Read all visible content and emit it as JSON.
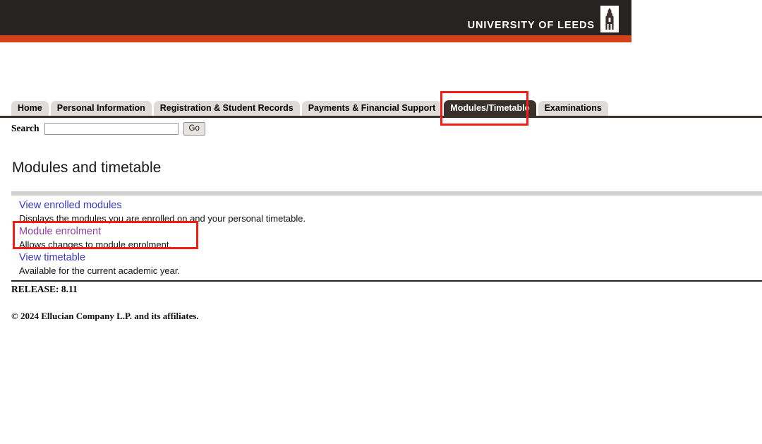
{
  "header": {
    "brand_name": "UNIVERSITY OF LEEDS",
    "logo_icon": "leeds-tower-icon",
    "bar_color": "#262322",
    "stripe_color": "#d5401a"
  },
  "tabs": [
    {
      "label": "Home",
      "active": false
    },
    {
      "label": "Personal Information",
      "active": false
    },
    {
      "label": "Registration & Student Records",
      "active": false
    },
    {
      "label": "Payments & Financial Support",
      "active": false
    },
    {
      "label": "Modules/Timetable",
      "active": true
    },
    {
      "label": "Examinations",
      "active": false
    }
  ],
  "search": {
    "label": "Search",
    "value": "",
    "placeholder": "",
    "button_label": "Go"
  },
  "main": {
    "title": "Modules and timetable",
    "links": [
      {
        "label": "View enrolled modules",
        "description": "Displays the modules you are enrolled on and your personal timetable.",
        "visited": false
      },
      {
        "label": "Module enrolment",
        "description": "Allows changes to module enrolment.",
        "visited": true
      },
      {
        "label": "View timetable",
        "description": "Available for the current academic year.",
        "visited": false
      }
    ]
  },
  "footer": {
    "release": "RELEASE: 8.11",
    "copyright": "© 2024 Ellucian Company L.P. and its affiliates."
  },
  "annotations": {
    "color": "#f51d13",
    "tab_highlight": "Modules/Timetable",
    "link_highlight": "Module enrolment"
  }
}
